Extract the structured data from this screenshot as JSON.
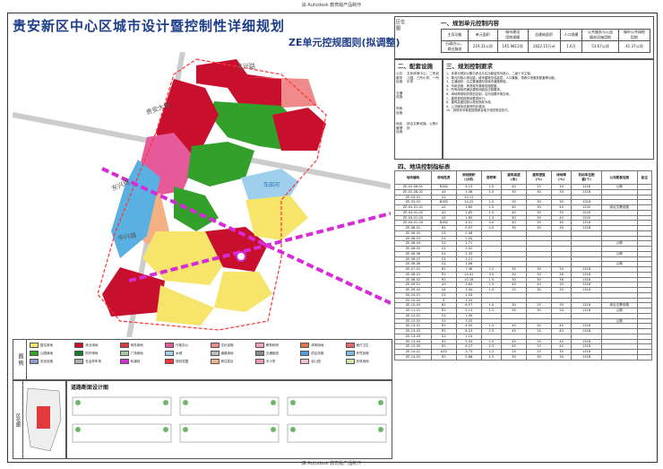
{
  "header": {
    "top_note": "由 Autodesk 教育版产品制作",
    "bottom_note": "由 Autodesk 教育版产品制作",
    "title": "贵安新区中心区城市设计暨控制性详细规划",
    "subtitle": "ZE单元控规图则(拟调整)"
  },
  "location_label": "区位\n图",
  "sec1": {
    "title": "一、规划单元控制内容",
    "side_label": "区位\n图",
    "headers": [
      "主导功能",
      "单元面积",
      "城市建设\n用地规模",
      "总建筑面积",
      "人口规模",
      "公共服务与公益\n服务设施用地",
      "城市公共绿地\n用地"
    ],
    "values": [
      "行政办公，\n商业服务",
      "219.31公顷",
      "145.9812顷",
      "1822.15万㎡",
      "1.6万",
      "51.67公顷",
      "41.37公顷"
    ]
  },
  "sec2": {
    "title": "二、配套设施",
    "side": [
      {
        "label": "公共\n服务\n设施",
        "text": "文化体育中心、二所幼儿园、三所小学、一所中学"
      },
      {
        "label": "交通\n设施",
        "text": ""
      },
      {
        "label": "市政\n设施",
        "text": ""
      },
      {
        "label": "地区\n管理\n设施",
        "text": "综合文教设施、公厕X处"
      }
    ]
  },
  "sec3": {
    "title": "三、规划控制要求",
    "notes": [
      "1、本单元规划以集中综合片区功能结构为核心，二级十字主轴。",
      "2、单元内核心带功能，城市建筑形成高层，人口集聚，带着中央服务配套等功能。",
      "3、交通组织：沿主要道路形成城市道路骨架。",
      "4、市政设施：考虑城市基础设施配套。",
      "5、所有用地须满足建筑间距及日照要求。",
      "6、绿地率按相关规范控制，沿河设置开敞空间。",
      "7、建筑退线按规划要求执行。",
      "8、建筑高度控制以规划指标为准。",
      "9、公共服务设施须同步建设。",
      "10、其他未尽事宜按国家及地方相关规定执行。"
    ]
  },
  "sec4": {
    "title": "四、地块控制指标表",
    "headers": [
      "地块编码",
      "用地性质",
      "用地面积\n(公顷)",
      "容积率",
      "建筑高度\n(米)",
      "建筑密度\n(%)",
      "绿地率\n(%)",
      "机动车位配\n套(个)",
      "公共配套设施",
      "备注"
    ],
    "rows": [
      [
        "ZE-02-06-01",
        "B1B2",
        "4.13",
        "1.0",
        "40",
        "25",
        "30",
        "1318",
        "公厕",
        ""
      ],
      [
        "ZE-02-06-02",
        "A5",
        "1.06",
        "1.0",
        "30",
        "30",
        "30",
        "1318",
        "",
        ""
      ],
      [
        "ZE-03-01",
        "G1",
        "10.11",
        "",
        "",
        "",
        "",
        "",
        "",
        ""
      ],
      [
        "ZE-03-02",
        "B1B2",
        "14.22",
        "1.5",
        "30",
        "30",
        "30",
        "1318",
        "",
        ""
      ],
      [
        "ZE-04-01-01",
        "A2",
        "1.60",
        "1.5",
        "40",
        "30",
        "40",
        "1200",
        "综合文教设施",
        ""
      ],
      [
        "ZE-04-01-02",
        "A2",
        "1.65",
        "1.5",
        "40",
        "30",
        "35",
        "1200",
        "",
        ""
      ],
      [
        "ZE-04-01-03",
        "A2",
        "1.65",
        "1.5",
        "40",
        "30",
        "40",
        "1200",
        "",
        ""
      ],
      [
        "ZE-04-01-04",
        "B1B2",
        "4.51",
        "3.0",
        "40",
        "35",
        "30",
        "1318",
        "",
        ""
      ],
      [
        "ZE-06-01",
        "B1",
        "0.97",
        "2.0",
        "30",
        "30",
        "30",
        "1318",
        "",
        ""
      ],
      [
        "ZE-06-02",
        "G1",
        "0.48",
        "",
        "",
        "",
        "",
        "",
        "",
        ""
      ],
      [
        "ZE-06-03",
        "G1",
        "2.20",
        "",
        "",
        "",
        "",
        "",
        "",
        ""
      ],
      [
        "ZE-06-04",
        "G1",
        "1.71",
        "",
        "",
        "",
        "",
        "",
        "公厕",
        ""
      ],
      [
        "ZE-06-05",
        "G1",
        "2.02",
        "",
        "",
        "",
        "",
        "",
        "",
        ""
      ],
      [
        "ZE-06-06",
        "G1",
        "2.33",
        "",
        "",
        "",
        "",
        "",
        "公厕",
        ""
      ],
      [
        "ZE-06-07",
        "G1",
        "1.21",
        "",
        "",
        "",
        "",
        "",
        "",
        ""
      ],
      [
        "ZE-06-08",
        "G1",
        "1.06",
        "",
        "",
        "",
        "",
        "",
        "公厕",
        ""
      ],
      [
        "ZE-07-01",
        "B1",
        "7.36",
        "2.5",
        "35",
        "30",
        "30",
        "1318",
        "",
        ""
      ],
      [
        "ZE-08-01",
        "R2",
        "10.41",
        "3.5",
        "30",
        "30",
        "36",
        "1318",
        "",
        ""
      ],
      [
        "ZE-08-02",
        "R2",
        "10.18",
        "1.5",
        "30",
        "30",
        "36",
        "1318",
        "",
        ""
      ],
      [
        "ZE-09-01",
        "A3",
        "3.64",
        "1.5",
        "45",
        "40",
        "30",
        "1318",
        "",
        ""
      ],
      [
        "ZE-09-02",
        "A2",
        "1.34",
        "1.0",
        "20",
        "30",
        "30",
        "1318",
        "",
        ""
      ],
      [
        "ZE-10-01",
        "G1",
        "1.53",
        "",
        "",
        "",
        "",
        "",
        "",
        ""
      ],
      [
        "ZE-10-02",
        "S",
        "1.24",
        "",
        "",
        "",
        "",
        "",
        "",
        ""
      ],
      [
        "ZE-10-03",
        "B1",
        "6.57",
        "1.0",
        "30",
        "25",
        "35",
        "1318",
        "综合文教设施",
        ""
      ],
      [
        "ZE-11-01",
        "R2",
        "5.13",
        "1.2",
        "35",
        "30",
        "34",
        "1318",
        "公厕",
        ""
      ],
      [
        "ZE-12-01",
        "G1",
        "1.39",
        "",
        "",
        "",
        "",
        "",
        "",
        ""
      ],
      [
        "ZE-12-02",
        "G1",
        "1.25",
        "",
        "",
        "",
        "",
        "",
        "公厕",
        ""
      ],
      [
        "ZE-13-01",
        "R2",
        "4.05",
        "1.5",
        "45",
        "30",
        "40",
        "1318",
        "",
        ""
      ],
      [
        "ZE-13-02",
        "R2",
        "8.23",
        "2.5",
        "45",
        "15",
        "40",
        "1318",
        "",
        ""
      ],
      [
        "ZE-13-03",
        "G1",
        "1.15",
        "",
        "",
        "",
        "",
        "",
        "",
        ""
      ],
      [
        "ZE-13-04",
        "R2",
        "5.03",
        "2.5",
        "45",
        "15",
        "40",
        "1318",
        "",
        ""
      ],
      [
        "ZE-13-05",
        "R2",
        "6.27",
        "2.5",
        "45",
        "15",
        "40",
        "1318",
        "",
        ""
      ],
      [
        "ZE-14-01",
        "A33",
        "3.73",
        "1.2",
        "24",
        "25",
        "35",
        "1318",
        "",
        ""
      ],
      [
        "ZE-14-02",
        "R2",
        "5.68",
        "1.5",
        "30",
        "30",
        "30",
        "1318",
        "",
        ""
      ]
    ]
  },
  "legend": {
    "title": "图\n例",
    "items": [
      {
        "label": "居住用地",
        "color": "#f7e56b"
      },
      {
        "label": "商业用地",
        "color": "#c8102e"
      },
      {
        "label": "商务用地",
        "color": "#e23a3a"
      },
      {
        "label": "行政办公",
        "color": "#e65a9a"
      },
      {
        "label": "文化设施",
        "color": "#f08a8a"
      },
      {
        "label": "教育科研",
        "color": "#f5a0b4"
      },
      {
        "label": "体育用地",
        "color": "#d97a4c"
      },
      {
        "label": "医疗卫生",
        "color": "#e8686a"
      },
      {
        "label": "公园绿地",
        "color": "#33a02c"
      },
      {
        "label": "防护绿地",
        "color": "#1b7a2b"
      },
      {
        "label": "广场用地",
        "color": "#a8c8a0"
      },
      {
        "label": "水域",
        "color": "#9ed0ee"
      },
      {
        "label": "道路用地",
        "color": "#bdbdbd"
      },
      {
        "label": "交通枢纽",
        "color": "#888888"
      },
      {
        "label": "供应设施",
        "color": "#5a9bd4"
      },
      {
        "label": "环境设施",
        "color": "#7fb8e0"
      },
      {
        "label": "安全设施",
        "color": "#8aa0c8"
      },
      {
        "label": "社会停车场",
        "color": "#b0b0b0"
      },
      {
        "label": "轨道线",
        "color": "#d62bd6"
      },
      {
        "label": "规划范围",
        "color": "#ff3333"
      },
      {
        "label": "商住混合",
        "color": "#f4b183"
      },
      {
        "label": "中小学",
        "color": "#f09ab0"
      },
      {
        "label": "幼儿园",
        "color": "#f7c2cf"
      },
      {
        "label": "农林用地",
        "color": "#cfe8a8"
      }
    ]
  },
  "road_section_title": "道路断面设计图",
  "map": {
    "labels": [
      {
        "text": "贵安大道",
        "id": "road-label-1"
      },
      {
        "text": "东兴路",
        "id": "road-label-2"
      },
      {
        "text": "中兴路",
        "id": "road-label-3"
      },
      {
        "text": "北兴路",
        "id": "road-label-4"
      },
      {
        "text": "车田河",
        "id": "river-label"
      }
    ]
  },
  "colors": {
    "title": "#1f3e8a",
    "residential": "#f7e56b",
    "commercial": "#c8102e",
    "green": "#33a02c",
    "water": "#9ed0ee",
    "admin": "#e65a9a",
    "rail": "#d62bd6",
    "boundary": "#ff3333"
  }
}
